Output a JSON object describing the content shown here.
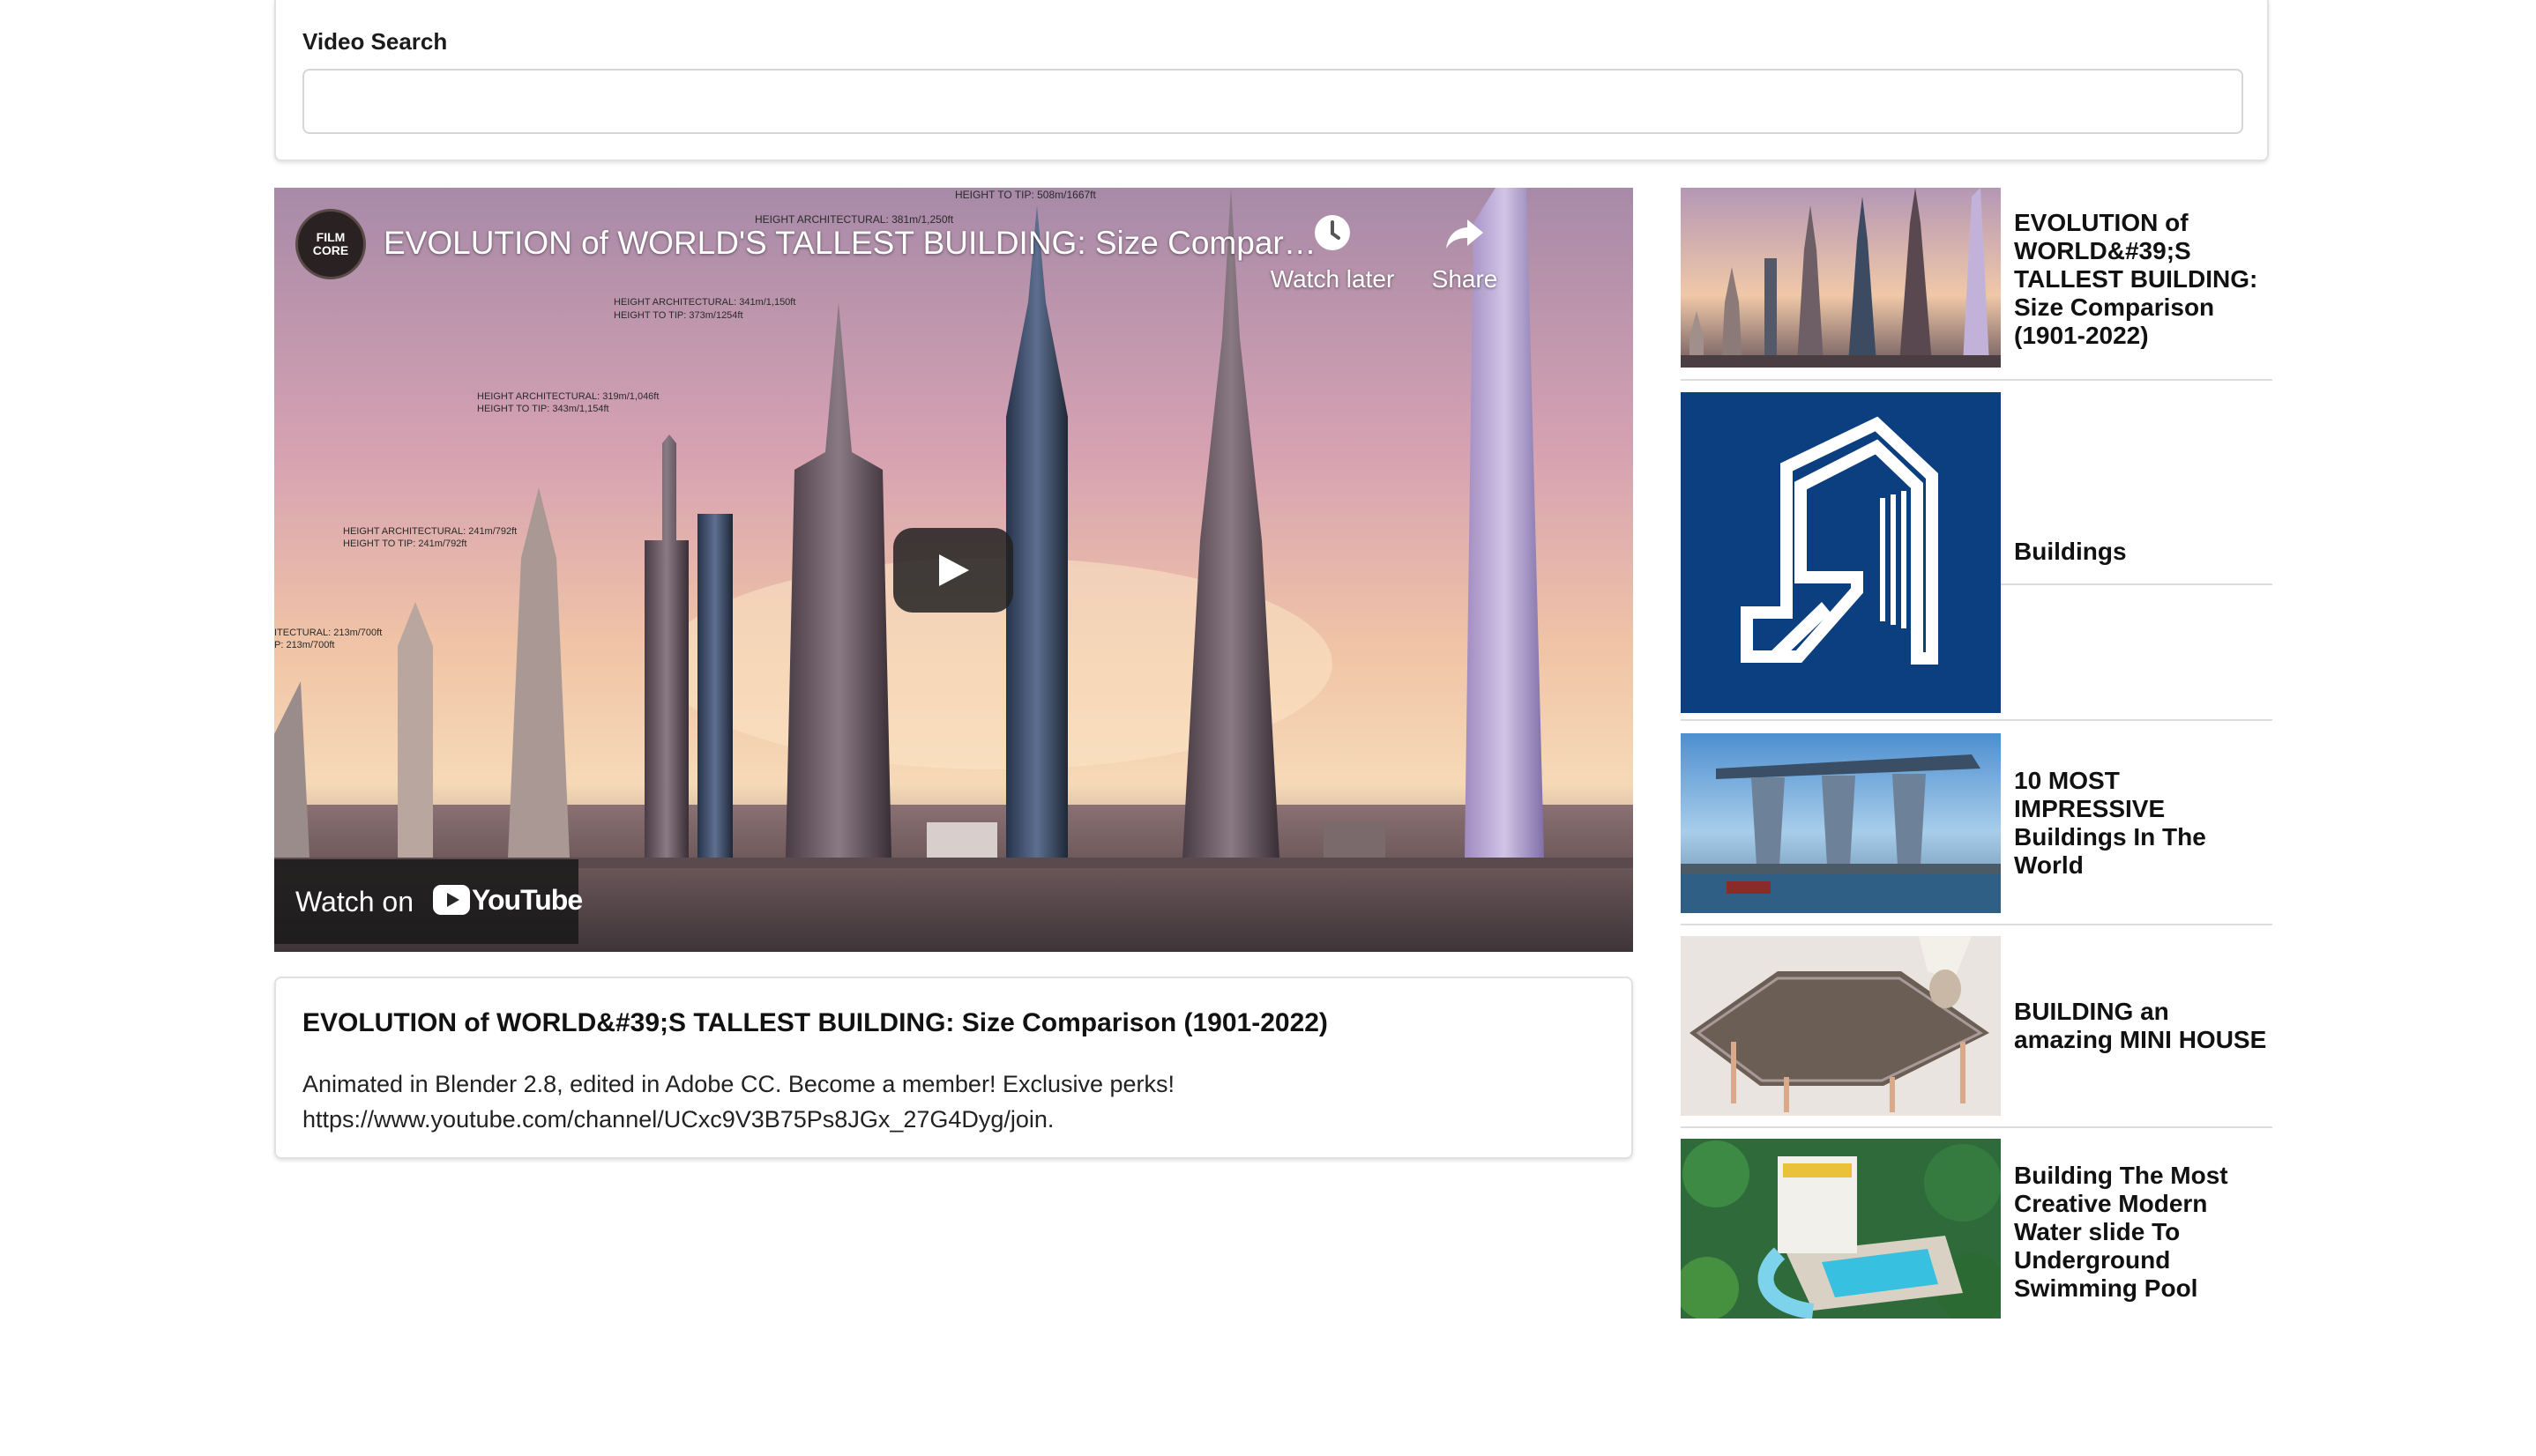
{
  "search": {
    "label": "Video Search",
    "value": "",
    "placeholder": ""
  },
  "player": {
    "channel_badge": "FILM CORE",
    "title": "EVOLUTION of WORLD'S TALLEST BUILDING: Size Comparison (...",
    "watch_later_label": "Watch later",
    "share_label": "Share",
    "watch_on_label": "Watch on",
    "youtube_label": "YouTube",
    "annotations": [
      "HEIGHT TO TIP: 508m/1667ft",
      "HEIGHT ARCHITECTURAL: 381m/1,250ft",
      "HEIGHT ARCHITECTURAL: 341m/1,150ft",
      "HEIGHT TO TIP: 373m/1254ft",
      "HEIGHT ARCHITECTURAL: 319m/1,046ft",
      "HEIGHT TO TIP: 343m/1,154ft",
      "HEIGHT ARCHITECTURAL: 241m/792ft",
      "HEIGHT TO TIP: 241m/792ft",
      "ITECTURAL: 213m/700ft",
      "P: 213m/700ft"
    ]
  },
  "video": {
    "title": "EVOLUTION of WORLD&#39;S TALLEST BUILDING: Size Comparison (1901-2022)",
    "description": "Animated in Blender 2.8, edited in Adobe CC. Become a member! Exclusive perks! https://www.youtube.com/channel/UCxc9V3B75Ps8JGx_27G4Dyg/join."
  },
  "related": [
    {
      "title": "EVOLUTION of WORLD&#39;S TALLEST BUILDING: Size Comparison (1901-2022)",
      "thumb": "skyline-thumbnail"
    },
    {
      "title": "Buildings",
      "thumb": "buildings-logo-thumbnail"
    },
    {
      "title": "10 MOST IMPRESSIVE Buildings In The World",
      "thumb": "marina-bay-thumbnail"
    },
    {
      "title": "BUILDING an amazing MINI HOUSE",
      "thumb": "mini-house-thumbnail"
    },
    {
      "title": "Building The Most Creative Modern Water slide To Underground Swimming Pool",
      "thumb": "water-slide-thumbnail"
    }
  ],
  "colors": {
    "youtube_red": "#ff0000",
    "buildings_logo_bg": "#0c3f7f"
  }
}
